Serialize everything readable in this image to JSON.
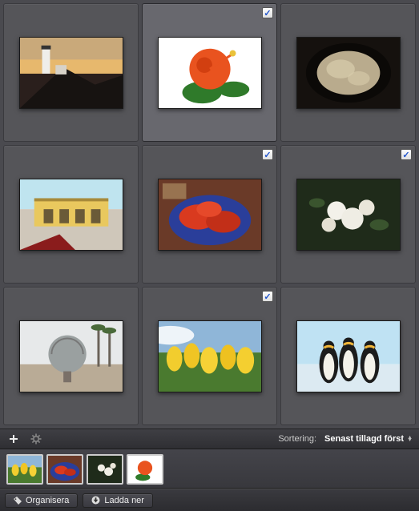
{
  "grid": {
    "items": [
      {
        "selected": false,
        "name": "lighthouse-sunset"
      },
      {
        "selected": true,
        "name": "hibiscus-flower"
      },
      {
        "selected": false,
        "name": "frying-pan"
      },
      {
        "selected": false,
        "name": "yellow-building"
      },
      {
        "selected": true,
        "name": "lobsters"
      },
      {
        "selected": true,
        "name": "white-blossoms"
      },
      {
        "selected": false,
        "name": "globe-studio"
      },
      {
        "selected": true,
        "name": "yellow-tulips"
      },
      {
        "selected": false,
        "name": "penguins"
      }
    ]
  },
  "toolbar": {
    "sort_label": "Sortering:",
    "sort_value": "Senast tillagd först"
  },
  "tray": {
    "items": [
      {
        "name": "yellow-tulips"
      },
      {
        "name": "lobsters"
      },
      {
        "name": "white-blossoms"
      },
      {
        "name": "hibiscus-flower"
      }
    ]
  },
  "bottom": {
    "organize_label": "Organisera",
    "download_label": "Ladda ner"
  }
}
